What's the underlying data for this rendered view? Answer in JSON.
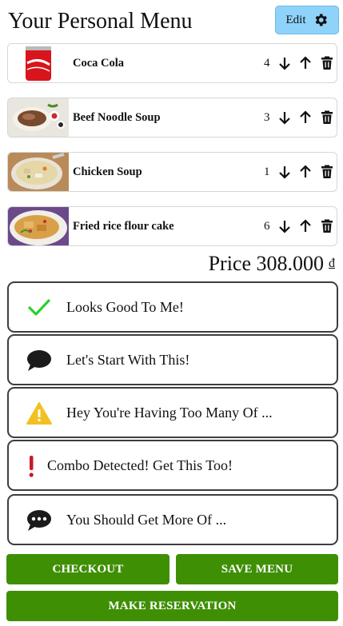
{
  "header": {
    "title": "Your Personal Menu",
    "edit_label": "Edit"
  },
  "items": [
    {
      "name": "Coca Cola",
      "qty": "4"
    },
    {
      "name": "Beef Noodle Soup",
      "qty": "3"
    },
    {
      "name": "Chicken Soup",
      "qty": "1"
    },
    {
      "name": "Fried rice flour cake",
      "qty": "6"
    }
  ],
  "price": {
    "label": "Price 308.000",
    "currency": "đ"
  },
  "suggestions": [
    {
      "text": "Looks Good To Me!",
      "icon": "checkmark-icon",
      "color": "#2bd12b"
    },
    {
      "text": "Let's Start With This!",
      "icon": "speech-bubble-icon",
      "color": "#1b1b1b"
    },
    {
      "text": "Hey You're Having Too Many Of ...",
      "icon": "warning-triangle-icon",
      "color": "#f4c021"
    },
    {
      "text": "Combo Detected! Get This Too!",
      "icon": "exclamation-icon",
      "color": "#c8192b"
    },
    {
      "text": "You Should Get More Of ...",
      "icon": "speech-bubble-dots-icon",
      "color": "#1b1b1b"
    }
  ],
  "actions": {
    "checkout": "CHECKOUT",
    "save_menu": "SAVE MENU",
    "reservation": "MAKE RESERVATION"
  },
  "colors": {
    "edit_bg": "#8fd3fb",
    "action_green": "#3f8f05"
  }
}
